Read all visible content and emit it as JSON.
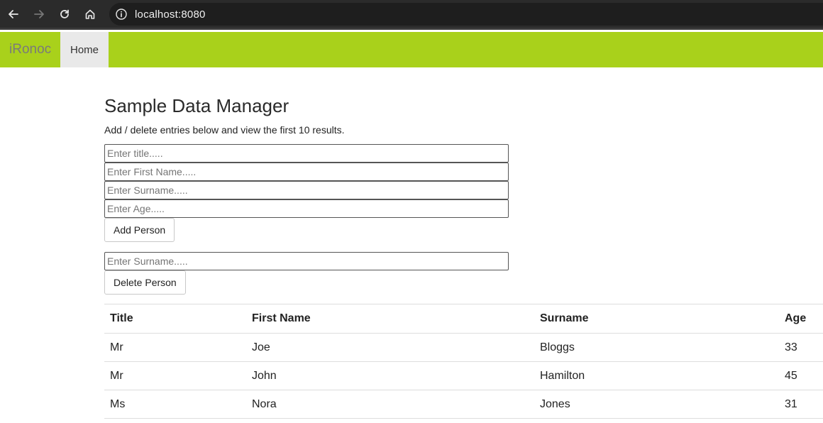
{
  "browser": {
    "url": "localhost:8080",
    "icons": [
      "back-arrow-icon",
      "forward-arrow-icon",
      "reload-icon",
      "home-icon",
      "info-icon"
    ]
  },
  "navbar": {
    "brand": "iRonoc",
    "home_label": "Home",
    "background": "#a9d11b"
  },
  "main": {
    "title": "Sample Data Manager",
    "subtitle": "Add / delete entries below and view the first 10 results.",
    "add_form": {
      "title_placeholder": "Enter title.....",
      "first_name_placeholder": "Enter First Name.....",
      "surname_placeholder": "Enter Surname.....",
      "age_placeholder": "Enter Age.....",
      "add_button": "Add Person"
    },
    "delete_form": {
      "surname_placeholder": "Enter Surname.....",
      "delete_button": "Delete Person"
    }
  },
  "table": {
    "headers": [
      "Title",
      "First Name",
      "Surname",
      "Age"
    ],
    "rows": [
      [
        "Mr",
        "Joe",
        "Bloggs",
        "33"
      ],
      [
        "Mr",
        "John",
        "Hamilton",
        "45"
      ],
      [
        "Ms",
        "Nora",
        "Jones",
        "31"
      ]
    ]
  }
}
